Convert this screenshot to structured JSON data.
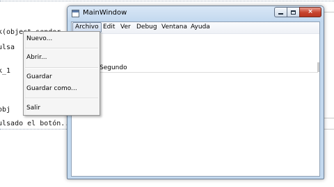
{
  "background_code": {
    "lines": [
      "k(object sender, Ev",
      "ulsa",
      "k_1",
      "obj",
      "ulsado el botón...\""
    ]
  },
  "window": {
    "title": "MainWindow",
    "close_glyph": "×"
  },
  "menubar": {
    "items": [
      "Archivo",
      "Edit",
      "Ver",
      "Debug",
      "Ventana",
      "Ayuda"
    ],
    "active_index": 0
  },
  "file_menu": {
    "items": [
      "Nuevo...",
      "Abrir...",
      "Guardar",
      "Guardar como...",
      "Salir"
    ]
  },
  "content": {
    "label": "Segundo"
  },
  "colors": {
    "title_bar": "#c2d8ef",
    "close_button": "#c6432e",
    "menu_bg": "#f5f5f5"
  }
}
